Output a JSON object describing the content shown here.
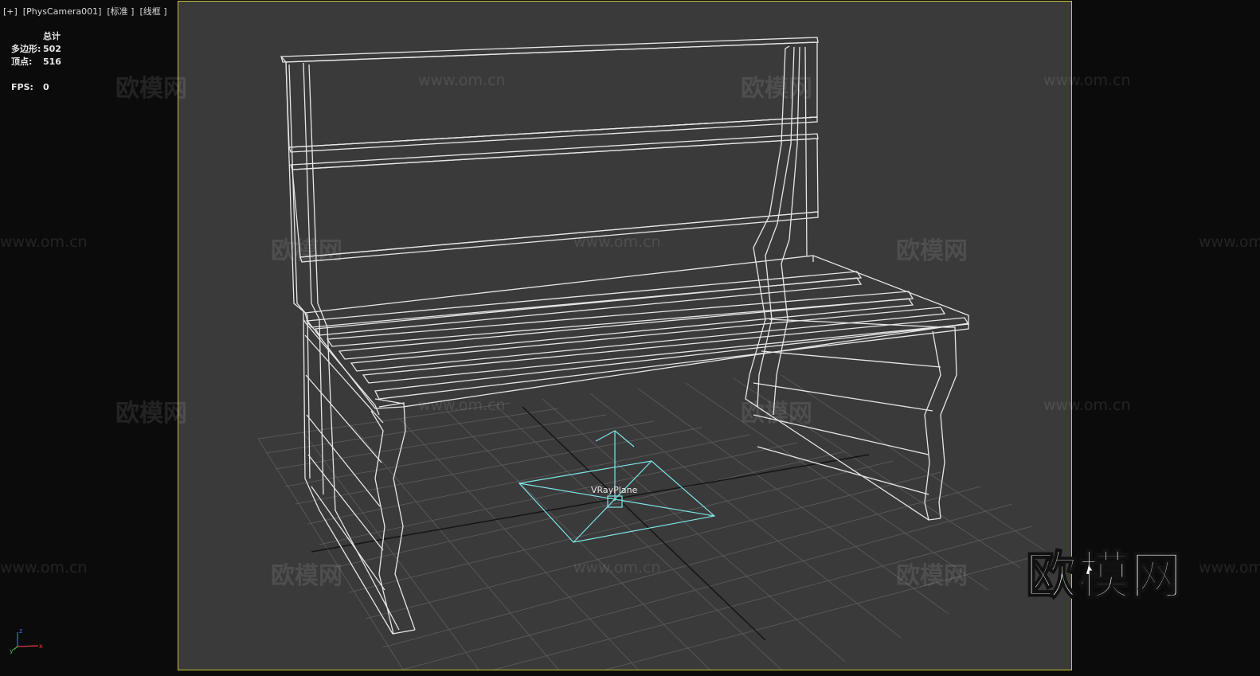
{
  "viewport": {
    "header": "[+]  [PhysCamera001]  [标准 ]  [线框 ]"
  },
  "stats": {
    "heading": "总计",
    "polygons_label": "多边形:",
    "polygons_value": "502",
    "vertices_label": "顶点:",
    "vertices_value": "516",
    "fps_label": "FPS:",
    "fps_value": "0"
  },
  "scene": {
    "object_label": "VRayPlane",
    "wire_color": "#e6e6e6",
    "plane_color": "#7fe3e6",
    "grid_color": "#555555",
    "frame_color": "#c9c63a"
  },
  "watermarks": {
    "brand_cn": "欧模网",
    "brand_url": "www.om.cn"
  },
  "logo": {
    "text": "欧模网"
  },
  "axis_gizmo": {
    "x_label": "x",
    "y_label": "y",
    "z_label": "z"
  }
}
